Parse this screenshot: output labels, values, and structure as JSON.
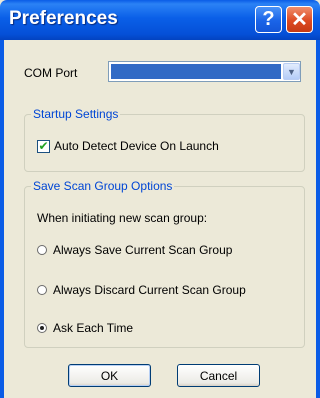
{
  "window": {
    "title": "Preferences",
    "help_glyph": "?",
    "close_glyph": "✕",
    "accent_color": "#0a5ce6"
  },
  "com_port": {
    "label": "COM Port",
    "selected_value": "",
    "arrow_glyph": "▼"
  },
  "startup": {
    "legend": "Startup Settings",
    "auto_detect": {
      "label": "Auto Detect Device On Launch",
      "checked": true,
      "check_glyph": "✔"
    }
  },
  "scan_group": {
    "legend": "Save Scan Group Options",
    "instruction": "When initiating new scan group:",
    "options": [
      {
        "label": "Always Save Current Scan Group",
        "selected": false
      },
      {
        "label": "Always Discard Current Scan Group",
        "selected": false
      },
      {
        "label": "Ask Each Time",
        "selected": true
      }
    ]
  },
  "buttons": {
    "ok_label": "OK",
    "cancel_label": "Cancel"
  }
}
